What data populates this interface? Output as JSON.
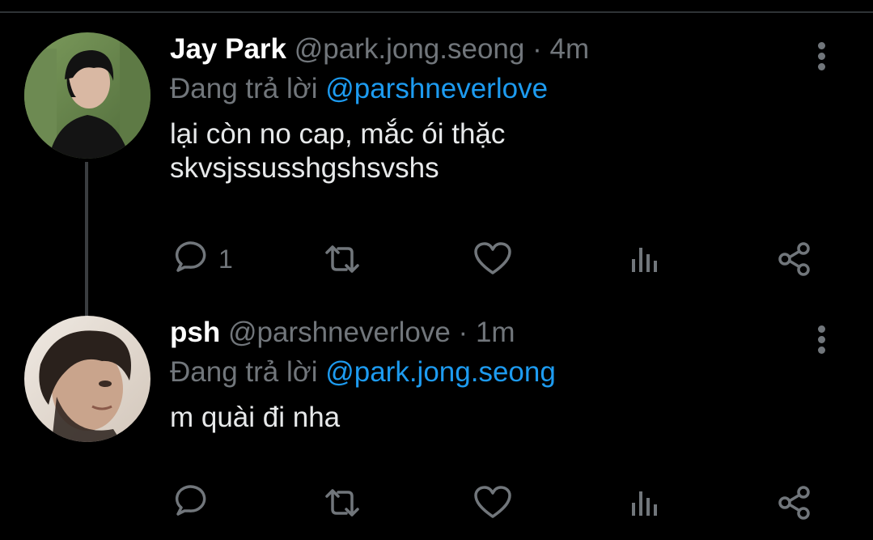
{
  "colors": {
    "background": "#000000",
    "text": "#e7e9ea",
    "secondary": "#71767b",
    "accent": "#1d9bf0",
    "thread_line": "#3a3d40"
  },
  "tweets": [
    {
      "display_name": "Jay Park",
      "handle": "@park.jong.seong",
      "separator": "·",
      "time": "4m",
      "reply_prefix": "Đang trả lời",
      "reply_to": "@parshneverlove",
      "text": "lại còn no cap, mắc ói thặc\nskvsjssusshgshsvshs",
      "reply_count": "1",
      "avatar_icon": "avatar-photo-icon"
    },
    {
      "display_name": "psh",
      "handle": "@parshneverlove",
      "separator": "·",
      "time": "1m",
      "reply_prefix": "Đang trả lời",
      "reply_to": "@park.jong.seong",
      "text": "m quài đi nha",
      "reply_count": "",
      "avatar_icon": "avatar-photo-icon"
    }
  ],
  "icons": {
    "reply": "reply-icon",
    "retweet": "retweet-icon",
    "like": "heart-icon",
    "views": "views-icon",
    "share": "share-icon",
    "more": "more-vertical-icon"
  }
}
